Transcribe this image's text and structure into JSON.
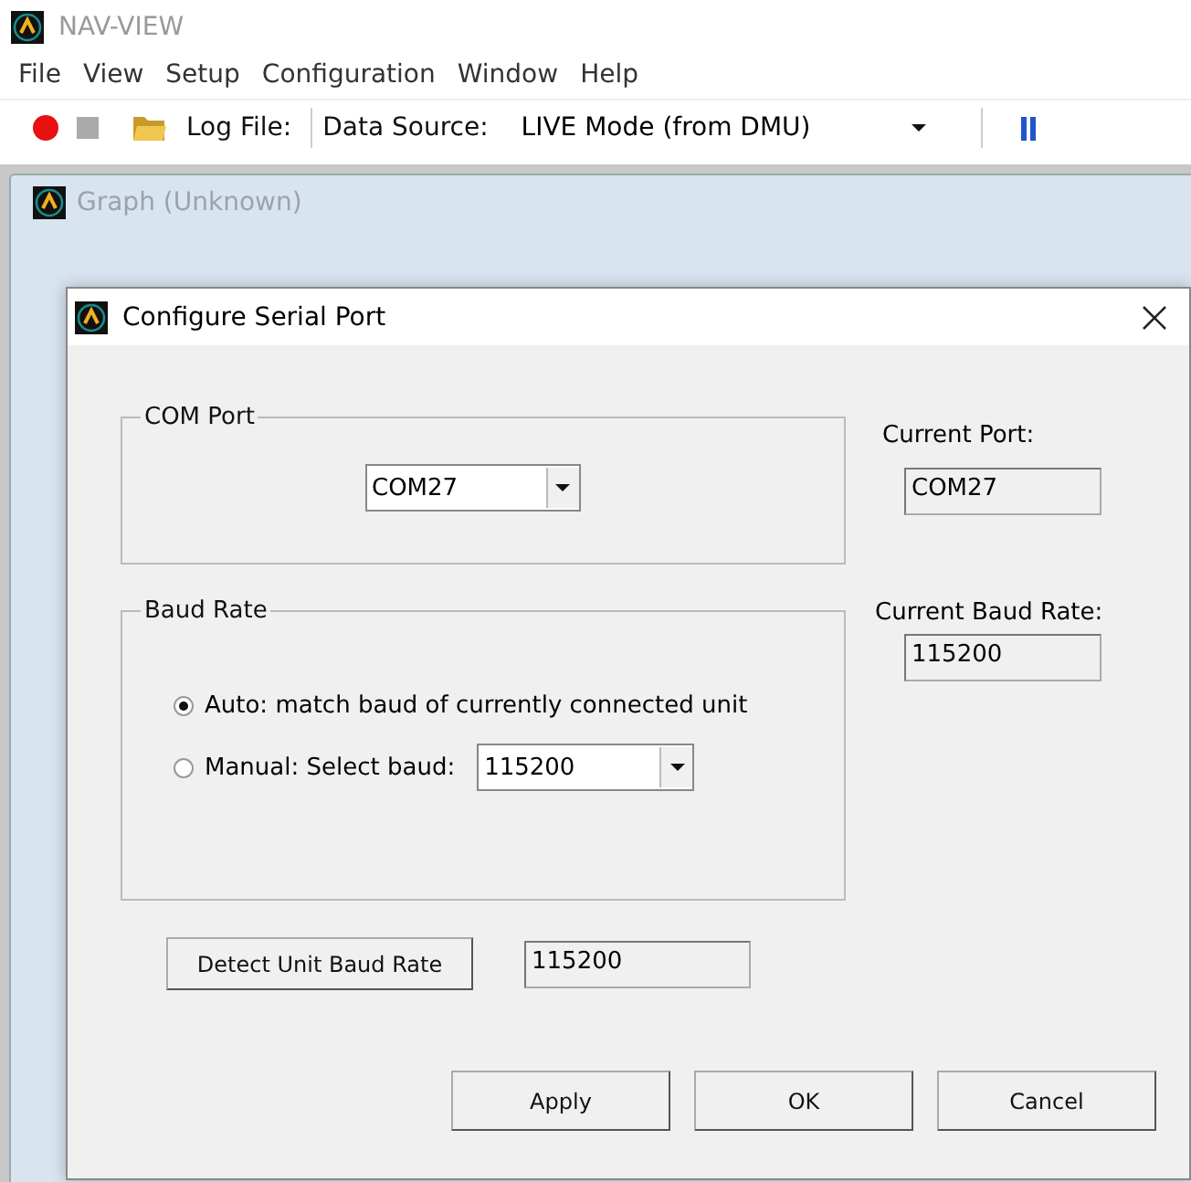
{
  "app": {
    "title": "NAV-VIEW"
  },
  "menu": [
    "File",
    "View",
    "Setup",
    "Configuration",
    "Window",
    "Help"
  ],
  "toolbar": {
    "log_file_label": "Log File:",
    "data_source_label": "Data Source:",
    "data_source": "LIVE Mode (from DMU)"
  },
  "child_window": {
    "title": "Graph (Unknown)"
  },
  "dialog": {
    "title": "Configure Serial Port",
    "com_port": {
      "legend": "COM Port",
      "value": "COM27"
    },
    "current_port": {
      "label": "Current Port:",
      "value": "COM27"
    },
    "baud_rate": {
      "legend": "Baud Rate",
      "options": [
        {
          "label": "Auto: match baud of currently connected unit",
          "selected": true,
          "kind": "plain"
        },
        {
          "label": "Manual: Select baud:",
          "selected": false,
          "kind": "select",
          "value": "115200"
        }
      ]
    },
    "current_baud": {
      "label": "Current Baud Rate:",
      "value": "115200"
    },
    "detect": {
      "button": "Detect Unit Baud Rate",
      "value": "115200"
    },
    "buttons": [
      "Apply",
      "OK",
      "Cancel"
    ]
  }
}
